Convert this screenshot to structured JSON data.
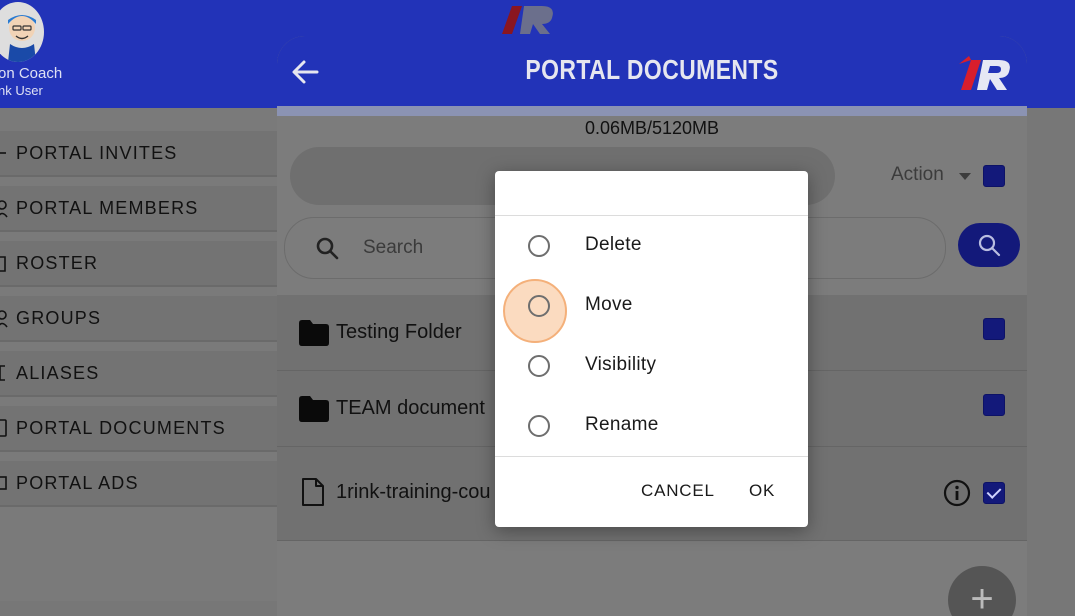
{
  "header": {
    "user_name": "on Coach",
    "user_role": "nk User"
  },
  "sidebar": {
    "items": [
      {
        "label": "PORTAL INVITES"
      },
      {
        "label": "PORTAL MEMBERS"
      },
      {
        "label": "ROSTER"
      },
      {
        "label": "GROUPS"
      },
      {
        "label": "ALIASES"
      },
      {
        "label": "PORTAL DOCUMENTS"
      },
      {
        "label": "PORTAL ADS"
      }
    ]
  },
  "sheet": {
    "title": "PORTAL DOCUMENTS",
    "storage": "0.06MB/5120MB",
    "action_label": "Action",
    "search_placeholder": "Search",
    "rows": [
      {
        "label": "Testing Folder",
        "kind": "folder",
        "checked": false
      },
      {
        "label": "TEAM document",
        "kind": "folder",
        "checked": false
      },
      {
        "label": "1rink-training-cou",
        "kind": "file",
        "checked": true
      }
    ]
  },
  "dialog": {
    "options": [
      {
        "label": "Delete"
      },
      {
        "label": "Move"
      },
      {
        "label": "Visibility"
      },
      {
        "label": "Rename"
      }
    ],
    "cancel_label": "CANCEL",
    "ok_label": "OK"
  },
  "colors": {
    "brand_blue": "#2233b8",
    "checkbox_blue": "#13197a",
    "logo_red": "#d81e2c"
  }
}
